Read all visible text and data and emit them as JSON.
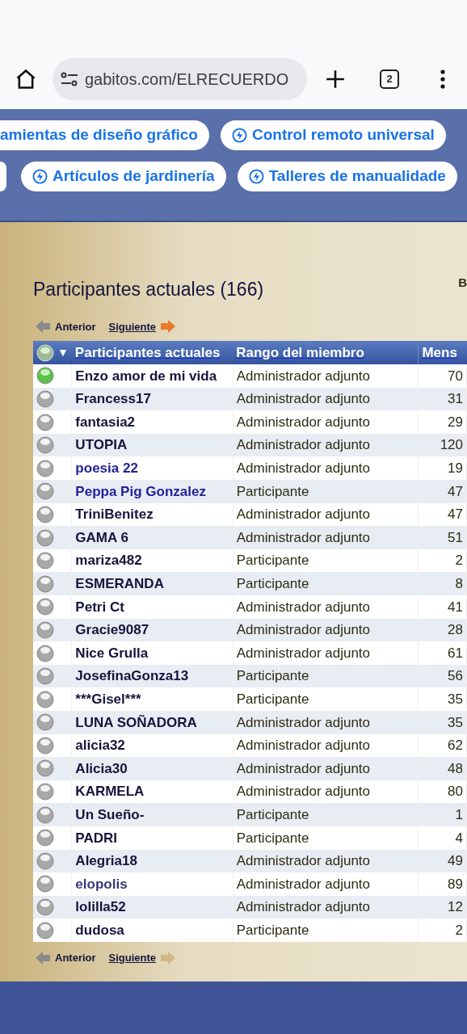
{
  "browser": {
    "url": "gabitos.com/ELRECUERDO",
    "tab_count": "2"
  },
  "chips": [
    [
      {
        "kind": "cut",
        "label": "amientas de diseño gráfico"
      },
      {
        "kind": "full",
        "label": "Control remoto universal"
      }
    ],
    [
      {
        "kind": "sliver"
      },
      {
        "kind": "full",
        "label": "Artículos de jardinería"
      },
      {
        "kind": "full",
        "label": "Talleres de manualidade"
      }
    ]
  ],
  "page": {
    "title": "Participantes actuales (166)",
    "side_text": "B"
  },
  "pager_top": {
    "previous": "Anterior",
    "next": "Siguiente"
  },
  "table": {
    "sort_marker": "▼",
    "columns": [
      "Participantes actuales",
      "Rango del miembro",
      "Mens"
    ],
    "rows": [
      {
        "name": "Enzo amor de mi vida",
        "rank": "Administrador adjunto",
        "posts": "70",
        "online": true,
        "color": "#14143c"
      },
      {
        "name": "Francess17",
        "rank": "Administrador adjunto",
        "posts": "31",
        "online": false,
        "color": "#14143c"
      },
      {
        "name": "fantasia2",
        "rank": "Administrador adjunto",
        "posts": "29",
        "online": false,
        "color": "#14143c"
      },
      {
        "name": "UTOPIA",
        "rank": "Administrador adjunto",
        "posts": "120",
        "online": false,
        "color": "#14143c"
      },
      {
        "name": "poesia 22",
        "rank": "Administrador adjunto",
        "posts": "19",
        "online": false,
        "color": "#22229a"
      },
      {
        "name": "Peppa Pig Gonzalez",
        "rank": "Participante",
        "posts": "47",
        "online": false,
        "color": "#22229a"
      },
      {
        "name": "TriniBenitez",
        "rank": "Administrador adjunto",
        "posts": "47",
        "online": false,
        "color": "#14143c"
      },
      {
        "name": "GAMA 6",
        "rank": "Administrador adjunto",
        "posts": "51",
        "online": false,
        "color": "#14143c"
      },
      {
        "name": "mariza482",
        "rank": "Participante",
        "posts": "2",
        "online": false,
        "color": "#14143c"
      },
      {
        "name": "ESMERANDA",
        "rank": "Participante",
        "posts": "8",
        "online": false,
        "color": "#14143c"
      },
      {
        "name": "Petri Ct",
        "rank": "Administrador adjunto",
        "posts": "41",
        "online": false,
        "color": "#14143c"
      },
      {
        "name": "Gracie9087",
        "rank": "Administrador adjunto",
        "posts": "28",
        "online": false,
        "color": "#14143c"
      },
      {
        "name": "Nice Grulla",
        "rank": "Administrador adjunto",
        "posts": "61",
        "online": false,
        "color": "#14143c"
      },
      {
        "name": "JosefinaGonza13",
        "rank": "Participante",
        "posts": "56",
        "online": false,
        "color": "#14143c"
      },
      {
        "name": "***Gisel***",
        "rank": "Participante",
        "posts": "35",
        "online": false,
        "color": "#14143c"
      },
      {
        "name": "LUNA SOÑADORA",
        "rank": "Administrador adjunto",
        "posts": "35",
        "online": false,
        "color": "#14143c"
      },
      {
        "name": "alicia32",
        "rank": "Administrador adjunto",
        "posts": "62",
        "online": false,
        "color": "#14143c"
      },
      {
        "name": "Alicia30",
        "rank": "Administrador adjunto",
        "posts": "48",
        "online": false,
        "color": "#14143c"
      },
      {
        "name": "KARMELA",
        "rank": "Administrador adjunto",
        "posts": "80",
        "online": false,
        "color": "#14143c"
      },
      {
        "name": "Un Sueño-",
        "rank": "Participante",
        "posts": "1",
        "online": false,
        "color": "#14143c"
      },
      {
        "name": "PADRI",
        "rank": "Participante",
        "posts": "4",
        "online": false,
        "color": "#14143c"
      },
      {
        "name": "Alegria18",
        "rank": "Administrador adjunto",
        "posts": "49",
        "online": false,
        "color": "#14143c"
      },
      {
        "name": "elopolis",
        "rank": "Administrador adjunto",
        "posts": "89",
        "online": false,
        "color": "#3a3a78"
      },
      {
        "name": "lolilla52",
        "rank": "Administrador adjunto",
        "posts": "12",
        "online": false,
        "color": "#14143c"
      },
      {
        "name": "dudosa",
        "rank": "Participante",
        "posts": "2",
        "online": false,
        "color": "#14143c"
      }
    ]
  },
  "pager_bottom": {
    "previous": "Anterior",
    "next": "Siguiente"
  }
}
